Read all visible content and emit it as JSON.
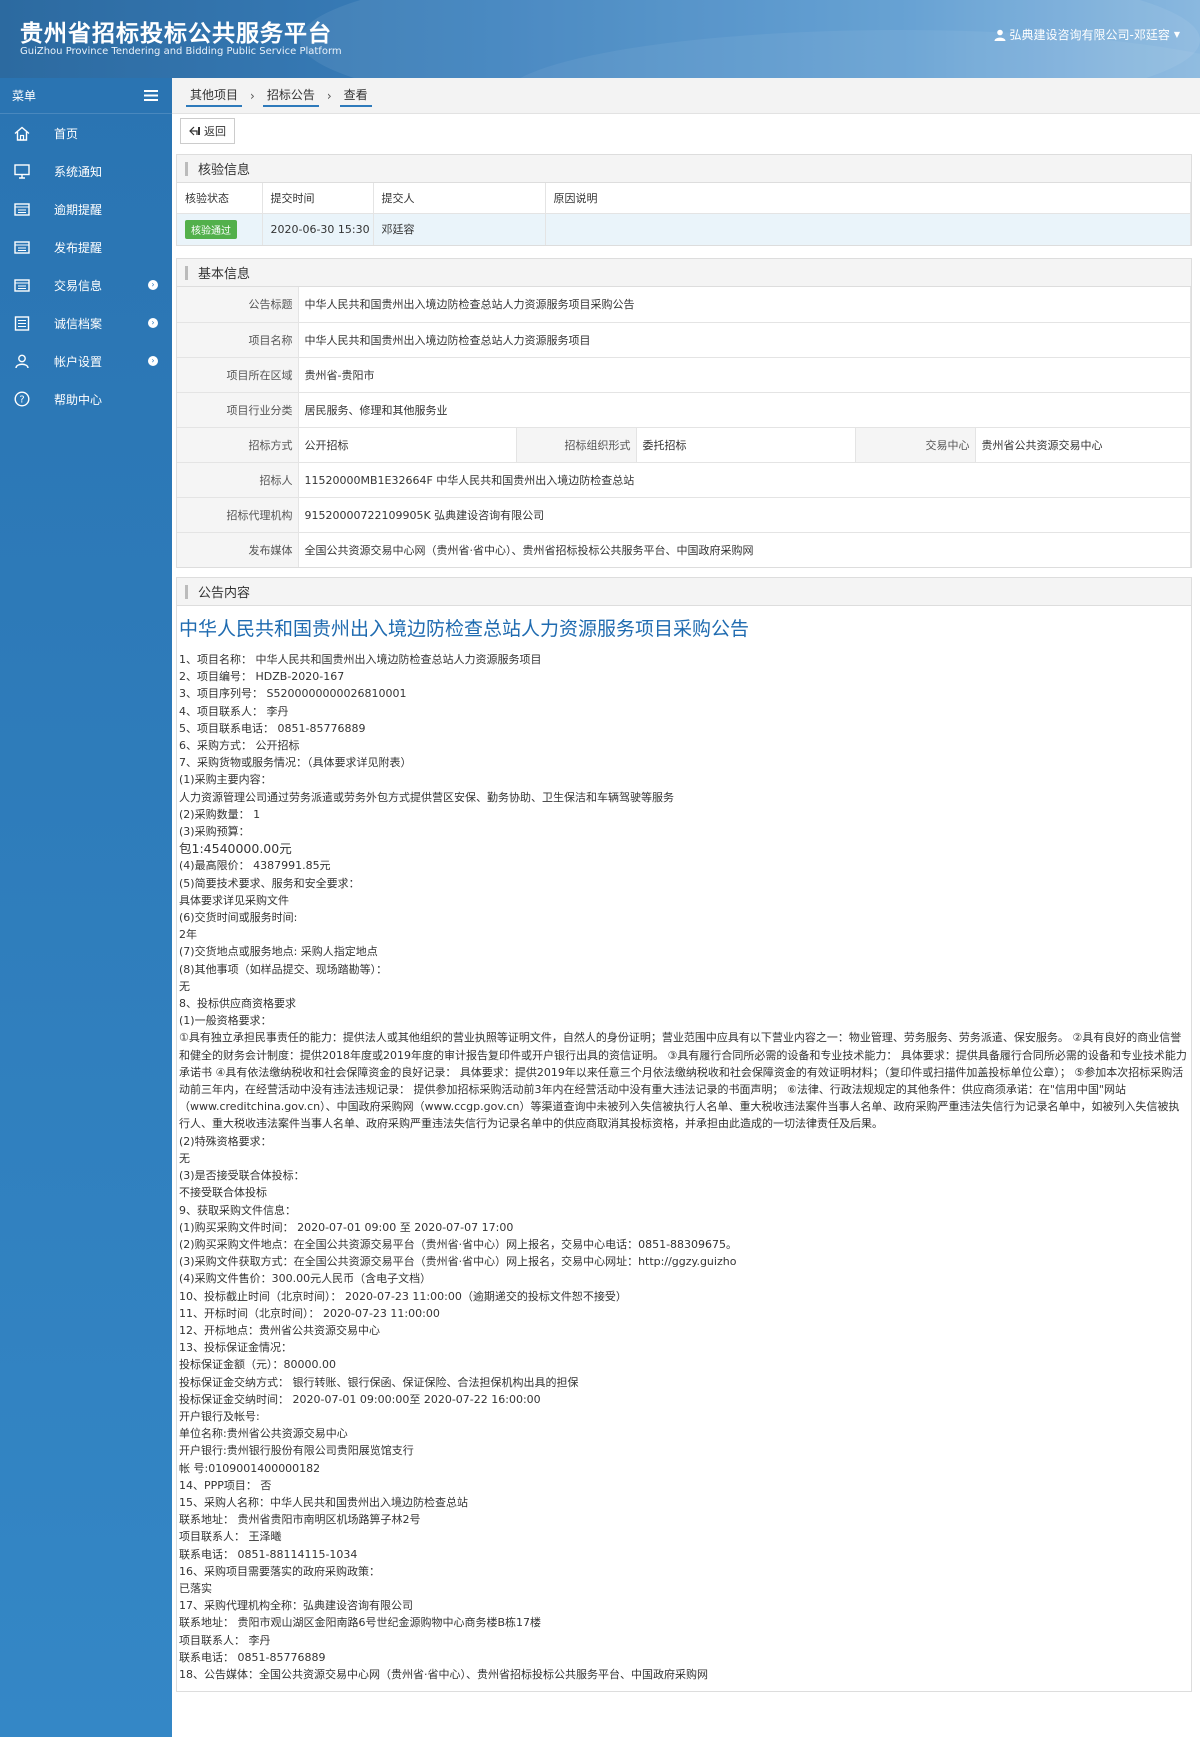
{
  "header": {
    "title_cn": "贵州省招标投标公共服务平台",
    "title_en": "GuiZhou Province Tendering and Bidding Public Service Platform",
    "user": "弘典建设咨询有限公司-邓廷容"
  },
  "sidebar": {
    "title": "菜单",
    "items": [
      {
        "label": "首页",
        "icon": "home-icon"
      },
      {
        "label": "系统通知",
        "icon": "monitor-icon"
      },
      {
        "label": "逾期提醒",
        "icon": "folder-icon"
      },
      {
        "label": "发布提醒",
        "icon": "folder-icon"
      },
      {
        "label": "交易信息",
        "icon": "folder-icon"
      },
      {
        "label": "诚信档案",
        "icon": "list-icon"
      },
      {
        "label": "帐户设置",
        "icon": "user-icon"
      },
      {
        "label": "帮助中心",
        "icon": "help-icon"
      }
    ]
  },
  "breadcrumb": [
    "其他项目",
    "招标公告",
    "查看"
  ],
  "toolbar": {
    "back_label": "返回"
  },
  "verify": {
    "title": "核验信息",
    "headers": [
      "核验状态",
      "提交时间",
      "提交人",
      "原因说明"
    ],
    "status": "核验通过",
    "time": "2020-06-30 15:30",
    "submitter": "邓廷容",
    "reason": ""
  },
  "basic": {
    "title": "基本信息",
    "notice_title_label": "公告标题",
    "notice_title": "中华人民共和国贵州出入境边防检查总站人力资源服务项目采购公告",
    "project_name_label": "项目名称",
    "project_name": "中华人民共和国贵州出入境边防检查总站人力资源服务项目",
    "region_label": "项目所在区域",
    "region": "贵州省-贵阳市",
    "industry_label": "项目行业分类",
    "industry": "居民服务、修理和其他服务业",
    "method_label": "招标方式",
    "method": "公开招标",
    "org_form_label": "招标组织形式",
    "org_form": "委托招标",
    "center_label": "交易中心",
    "center": "贵州省公共资源交易中心",
    "tenderer_label": "招标人",
    "tenderer": "11520000MB1E32664F 中华人民共和国贵州出入境边防检查总站",
    "agency_label": "招标代理机构",
    "agency": "91520000722109905K 弘典建设咨询有限公司",
    "media_label": "发布媒体",
    "media": "全国公共资源交易中心网（贵州省·省中心）、贵州省招标投标公共服务平台、中国政府采购网"
  },
  "content": {
    "title": "公告内容",
    "heading": "中华人民共和国贵州出入境边防检查总站人力资源服务项目采购公告",
    "lines": [
      "1、项目名称： 中华人民共和国贵州出入境边防检查总站人力资源服务项目",
      "2、项目编号： HDZB-2020-167",
      "3、项目序列号： S5200000000026810001",
      "4、项目联系人： 李丹",
      "5、项目联系电话： 0851-85776889",
      "6、采购方式： 公开招标",
      "7、采购货物或服务情况：（具体要求详见附表）",
      "(1)采购主要内容：",
      "人力资源管理公司通过劳务派遣或劳务外包方式提供营区安保、勤务协助、卫生保洁和车辆驾驶等服务",
      "(2)采购数量： 1",
      "(3)采购预算：",
      "包1:4540000.00元",
      "(4)最高限价： 4387991.85元",
      "(5)简要技术要求、服务和安全要求：",
      "具体要求详见采购文件",
      "(6)交货时间或服务时间:",
      "2年",
      "(7)交货地点或服务地点: 采购人指定地点",
      "(8)其他事项（如样品提交、现场踏勘等）：",
      "无",
      "8、投标供应商资格要求",
      "(1)一般资格要求：",
      "①具有独立承担民事责任的能力：提供法人或其他组织的营业执照等证明文件，自然人的身份证明；营业范围中应具有以下营业内容之一：物业管理、劳务服务、劳务派遣、保安服务。 ②具有良好的商业信誉和健全的财务会计制度：提供2018年度或2019年度的审计报告复印件或开户银行出具的资信证明。 ③具有履行合同所必需的设备和专业技术能力： 具体要求：提供具备履行合同所必需的设备和专业技术能力承诺书 ④具有依法缴纳税收和社会保障资金的良好记录： 具体要求：提供2019年以来任意三个月依法缴纳税收和社会保障资金的有效证明材料；（复印件或扫描件加盖投标单位公章）； ⑤参加本次招标采购活动前三年内，在经营活动中没有违法违规记录： 提供参加招标采购活动前3年内在经营活动中没有重大违法记录的书面声明； ⑥法律、行政法规规定的其他条件：供应商须承诺：在\"信用中国\"网站（www.creditchina.gov.cn）、中国政府采购网（www.ccgp.gov.cn）等渠道查询中未被列入失信被执行人名单、重大税收违法案件当事人名单、政府采购严重违法失信行为记录名单中，如被列入失信被执行人、重大税收违法案件当事人名单、政府采购严重违法失信行为记录名单中的供应商取消其投标资格，并承担由此造成的一切法律责任及后果。",
      "(2)特殊资格要求：",
      "无",
      " (3)是否接受联合体投标：",
      "不接受联合体投标",
      "9、获取采购文件信息：",
      "(1)购买采购文件时间： 2020-07-01 09:00 至 2020-07-07 17:00",
      "(2)购买采购文件地点：在全国公共资源交易平台（贵州省·省中心）网上报名，交易中心电话：0851-88309675。",
      "(3)采购文件获取方式：在全国公共资源交易平台（贵州省·省中心）网上报名，交易中心网址：http://ggzy.guizho",
      "(4)采购文件售价：300.00元人民币（含电子文档）",
      "10、投标截止时间（北京时间）： 2020-07-23 11:00:00（逾期递交的投标文件恕不接受）",
      "11、开标时间（北京时间）： 2020-07-23 11:00:00",
      "12、开标地点：贵州省公共资源交易中心",
      "13、投标保证金情况：",
      "投标保证金额（元）：80000.00",
      "投标保证金交纳方式： 银行转账、银行保函、保证保险、合法担保机构出具的担保",
      "投标保证金交纳时间： 2020-07-01 09:00:00至 2020-07-22 16:00:00",
      " 开户银行及帐号:",
      "单位名称:贵州省公共资源交易中心",
      "开户银行:贵州银行股份有限公司贵阳展览馆支行",
      "帐 号:0109001400000182",
      "14、PPP项目： 否",
      "15、采购人名称：中华人民共和国贵州出入境边防检查总站",
      "联系地址： 贵州省贵阳市南明区机场路箅子林2号",
      "项目联系人： 王泽曦",
      "联系电话： 0851-88114115-1034",
      "16、采购项目需要落实的政府采购政策：",
      "已落实",
      "17、采购代理机构全称：弘典建设咨询有限公司",
      "联系地址： 贵阳市观山湖区金阳南路6号世纪金源购物中心商务楼B栋17楼",
      "项目联系人： 李丹",
      "联系电话： 0851-85776889",
      "18、公告媒体：全国公共资源交易中心网（贵州省·省中心）、贵州省招标投标公共服务平台、中国政府采购网"
    ]
  }
}
